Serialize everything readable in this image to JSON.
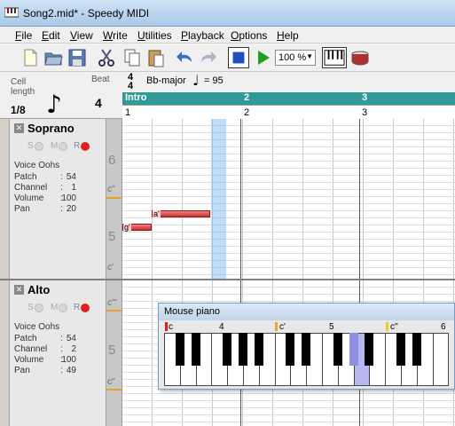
{
  "window": {
    "title": "Song2.mid* - Speedy MIDI"
  },
  "menu": [
    {
      "label": "File",
      "u": "F",
      "rest": "ile"
    },
    {
      "label": "Edit",
      "u": "E",
      "rest": "dit"
    },
    {
      "label": "View",
      "u": "V",
      "rest": "iew"
    },
    {
      "label": "Write",
      "u": "W",
      "rest": "rite"
    },
    {
      "label": "Utilities",
      "u": "U",
      "rest": "tilities"
    },
    {
      "label": "Playback",
      "u": "P",
      "rest": "layback"
    },
    {
      "label": "Options",
      "u": "O",
      "rest": "ptions"
    },
    {
      "label": "Help",
      "u": "H",
      "rest": "elp"
    }
  ],
  "toolbar": {
    "icons": [
      "new-file-icon",
      "open-folder-icon",
      "save-icon",
      "cut-icon",
      "copy-icon",
      "paste-icon",
      "undo-icon",
      "redo-icon",
      "stop-icon",
      "play-icon",
      "piano-icon",
      "drum-icon"
    ],
    "zoom": "100 %"
  },
  "header": {
    "cell_label": "Cell length",
    "cell_value": "1/8",
    "beat_label": "Beat",
    "beat_value": "4",
    "time_sig_top": "4",
    "time_sig_bottom": "4",
    "key": "Bb-major",
    "tempo": "= 95",
    "sections": [
      {
        "label": "Intro"
      },
      {
        "label": "2"
      },
      {
        "label": "3"
      }
    ],
    "ruler": [
      "1",
      "2",
      "3"
    ]
  },
  "tracks": [
    {
      "name": "Soprano",
      "s": "S",
      "m": "M",
      "r": "R",
      "voice": "Voice Oohs",
      "props": [
        {
          "k": "Patch",
          "v": "54"
        },
        {
          "k": "Channel",
          "v": "1"
        },
        {
          "k": "Volume",
          "v": "100"
        },
        {
          "k": "Pan",
          "v": "20"
        }
      ],
      "scale": {
        "o1": "6",
        "c1": "c''",
        "o2": "5",
        "c2": "c'"
      },
      "notes": [
        {
          "label": "a'"
        },
        {
          "label": "g'"
        }
      ]
    },
    {
      "name": "Alto",
      "s": "S",
      "m": "M",
      "r": "R",
      "voice": "Voice Oohs",
      "props": [
        {
          "k": "Patch",
          "v": "54"
        },
        {
          "k": "Channel",
          "v": "2"
        },
        {
          "k": "Volume",
          "v": "100"
        },
        {
          "k": "Pan",
          "v": "49"
        }
      ],
      "scale": {
        "c0": "c'''",
        "o1": "5",
        "c1": "c''"
      }
    }
  ],
  "piano": {
    "title": "Mouse piano",
    "labels": [
      "c",
      "4",
      "c'",
      "5",
      "c''",
      "6"
    ]
  },
  "colors": {
    "section_bar": "#2f9a96",
    "note_red": "#d84040",
    "playhead": "#9cc8f0",
    "record_dot": "#e02020",
    "key_highlight": "#b8b8f0"
  }
}
